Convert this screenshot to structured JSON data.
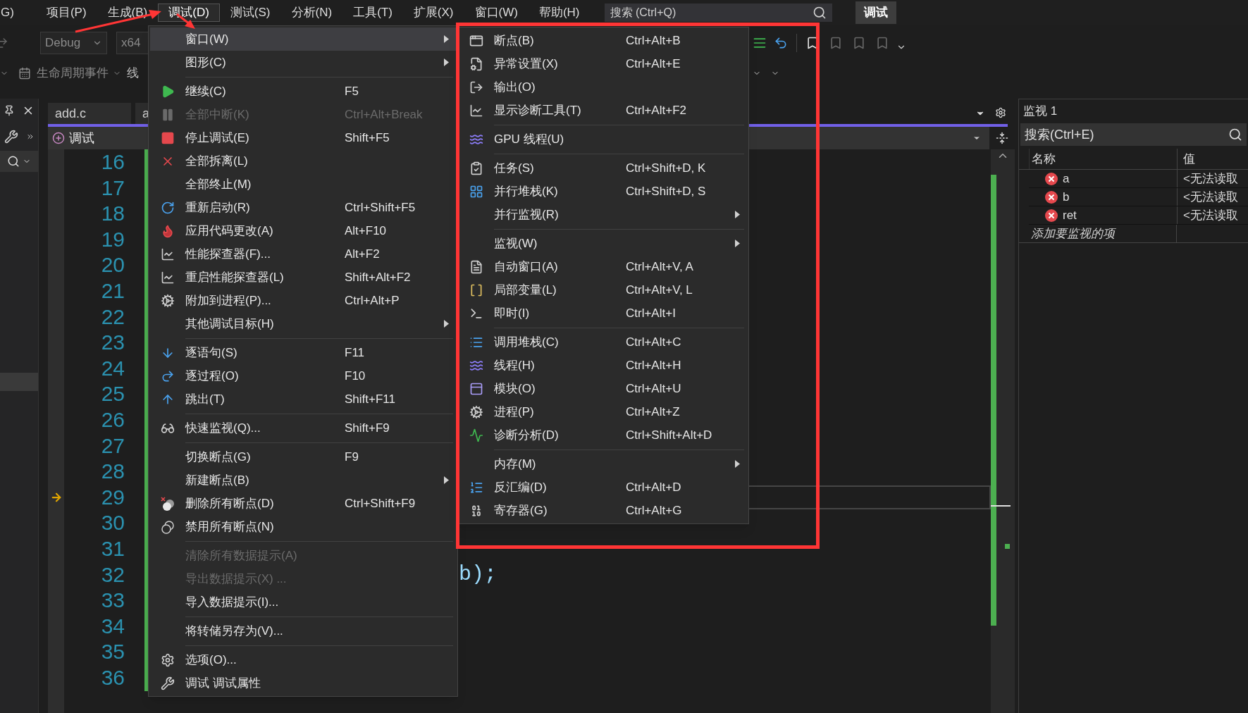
{
  "menu_bar": {
    "items": [
      {
        "label": "G)",
        "selected": false
      },
      {
        "label": "项目(P)",
        "selected": false
      },
      {
        "label": "生成(B)",
        "selected": false
      },
      {
        "label": "调试(D)",
        "selected": true
      },
      {
        "label": "测试(S)",
        "selected": false
      },
      {
        "label": "分析(N)",
        "selected": false
      },
      {
        "label": "工具(T)",
        "selected": false
      },
      {
        "label": "扩展(X)",
        "selected": false
      },
      {
        "label": "窗口(W)",
        "selected": false
      },
      {
        "label": "帮助(H)",
        "selected": false
      }
    ],
    "search": {
      "placeholder": "搜索 (Ctrl+Q)"
    },
    "badge": "调试"
  },
  "toolbar": {
    "configuration": "Debug",
    "platform": "x64",
    "lifecycle": "生命周期事件",
    "thread": "线"
  },
  "debug_menu": {
    "items": [
      {
        "kind": "item",
        "label": "窗口(W)",
        "submenu": true,
        "disabled": false,
        "selected": true
      },
      {
        "kind": "item",
        "label": "图形(C)",
        "submenu": true,
        "disabled": false,
        "selected": false
      },
      {
        "kind": "separator"
      },
      {
        "kind": "item",
        "label": "继续(C)",
        "shortcut": "F5",
        "submenu": false,
        "disabled": false,
        "selected": false
      },
      {
        "kind": "item",
        "label": "全部中断(K)",
        "shortcut": "Ctrl+Alt+Break",
        "submenu": false,
        "disabled": true,
        "selected": false
      },
      {
        "kind": "item",
        "label": "停止调试(E)",
        "shortcut": "Shift+F5",
        "submenu": false,
        "disabled": false,
        "selected": false
      },
      {
        "kind": "item",
        "label": "全部拆离(L)",
        "submenu": false,
        "disabled": false,
        "selected": false
      },
      {
        "kind": "item",
        "label": "全部终止(M)",
        "submenu": false,
        "disabled": false,
        "selected": false
      },
      {
        "kind": "item",
        "label": "重新启动(R)",
        "shortcut": "Ctrl+Shift+F5",
        "submenu": false,
        "disabled": false,
        "selected": false
      },
      {
        "kind": "item",
        "label": "应用代码更改(A)",
        "shortcut": "Alt+F10",
        "submenu": false,
        "disabled": false,
        "selected": false
      },
      {
        "kind": "item",
        "label": "性能探查器(F)...",
        "shortcut": "Alt+F2",
        "submenu": false,
        "disabled": false,
        "selected": false
      },
      {
        "kind": "item",
        "label": "重启性能探查器(L)",
        "shortcut": "Shift+Alt+F2",
        "submenu": false,
        "disabled": false,
        "selected": false
      },
      {
        "kind": "item",
        "label": "附加到进程(P)...",
        "shortcut": "Ctrl+Alt+P",
        "submenu": false,
        "disabled": false,
        "selected": false
      },
      {
        "kind": "item",
        "label": "其他调试目标(H)",
        "submenu": true,
        "disabled": false,
        "selected": false
      },
      {
        "kind": "separator"
      },
      {
        "kind": "item",
        "label": "逐语句(S)",
        "shortcut": "F11",
        "submenu": false,
        "disabled": false,
        "selected": false
      },
      {
        "kind": "item",
        "label": "逐过程(O)",
        "shortcut": "F10",
        "submenu": false,
        "disabled": false,
        "selected": false
      },
      {
        "kind": "item",
        "label": "跳出(T)",
        "shortcut": "Shift+F11",
        "submenu": false,
        "disabled": false,
        "selected": false
      },
      {
        "kind": "separator"
      },
      {
        "kind": "item",
        "label": "快速监视(Q)...",
        "shortcut": "Shift+F9",
        "submenu": false,
        "disabled": false,
        "selected": false
      },
      {
        "kind": "separator"
      },
      {
        "kind": "item",
        "label": "切换断点(G)",
        "shortcut": "F9",
        "submenu": false,
        "disabled": false,
        "selected": false
      },
      {
        "kind": "item",
        "label": "新建断点(B)",
        "submenu": true,
        "disabled": false,
        "selected": false
      },
      {
        "kind": "item",
        "label": "删除所有断点(D)",
        "shortcut": "Ctrl+Shift+F9",
        "submenu": false,
        "disabled": false,
        "selected": false
      },
      {
        "kind": "item",
        "label": "禁用所有断点(N)",
        "submenu": false,
        "disabled": false,
        "selected": false
      },
      {
        "kind": "separator"
      },
      {
        "kind": "item",
        "label": "清除所有数据提示(A)",
        "submenu": false,
        "disabled": true,
        "selected": false
      },
      {
        "kind": "item",
        "label": "导出数据提示(X) ...",
        "submenu": false,
        "disabled": true,
        "selected": false
      },
      {
        "kind": "item",
        "label": "导入数据提示(I)...",
        "submenu": false,
        "disabled": false,
        "selected": false
      },
      {
        "kind": "separator"
      },
      {
        "kind": "item",
        "label": "将转储另存为(V)...",
        "submenu": false,
        "disabled": false,
        "selected": false
      },
      {
        "kind": "separator"
      },
      {
        "kind": "item",
        "label": "选项(O)...",
        "submenu": false,
        "disabled": false,
        "selected": false
      },
      {
        "kind": "item",
        "label": "调试 调试属性",
        "submenu": false,
        "disabled": false,
        "selected": false
      }
    ]
  },
  "window_submenu": {
    "items": [
      {
        "kind": "item",
        "label": "断点(B)",
        "shortcut": "Ctrl+Alt+B",
        "submenu": false,
        "selected": false
      },
      {
        "kind": "item",
        "label": "异常设置(X)",
        "shortcut": "Ctrl+Alt+E",
        "submenu": false,
        "selected": false
      },
      {
        "kind": "item",
        "label": "输出(O)",
        "submenu": false,
        "selected": false
      },
      {
        "kind": "item",
        "label": "显示诊断工具(T)",
        "shortcut": "Ctrl+Alt+F2",
        "submenu": false,
        "selected": false
      },
      {
        "kind": "separator"
      },
      {
        "kind": "item",
        "label": "GPU 线程(U)",
        "submenu": false,
        "selected": false
      },
      {
        "kind": "separator"
      },
      {
        "kind": "item",
        "label": "任务(S)",
        "shortcut": "Ctrl+Shift+D, K",
        "submenu": false,
        "selected": false
      },
      {
        "kind": "item",
        "label": "并行堆栈(K)",
        "shortcut": "Ctrl+Shift+D, S",
        "submenu": false,
        "selected": false
      },
      {
        "kind": "item",
        "label": "并行监视(R)",
        "submenu": true,
        "selected": false
      },
      {
        "kind": "separator"
      },
      {
        "kind": "item",
        "label": "监视(W)",
        "submenu": true,
        "selected": false
      },
      {
        "kind": "item",
        "label": "自动窗口(A)",
        "shortcut": "Ctrl+Alt+V, A",
        "submenu": false,
        "selected": false
      },
      {
        "kind": "item",
        "label": "局部变量(L)",
        "shortcut": "Ctrl+Alt+V, L",
        "submenu": false,
        "selected": false
      },
      {
        "kind": "item",
        "label": "即时(I)",
        "shortcut": "Ctrl+Alt+I",
        "submenu": false,
        "selected": false
      },
      {
        "kind": "separator"
      },
      {
        "kind": "item",
        "label": "调用堆栈(C)",
        "shortcut": "Ctrl+Alt+C",
        "submenu": false,
        "selected": false
      },
      {
        "kind": "item",
        "label": "线程(H)",
        "shortcut": "Ctrl+Alt+H",
        "submenu": false,
        "selected": false
      },
      {
        "kind": "item",
        "label": "模块(O)",
        "shortcut": "Ctrl+Alt+U",
        "submenu": false,
        "selected": false
      },
      {
        "kind": "item",
        "label": "进程(P)",
        "shortcut": "Ctrl+Alt+Z",
        "submenu": false,
        "selected": false
      },
      {
        "kind": "item",
        "label": "诊断分析(D)",
        "shortcut": "Ctrl+Shift+Alt+D",
        "submenu": false,
        "selected": false
      },
      {
        "kind": "separator"
      },
      {
        "kind": "item",
        "label": "内存(M)",
        "submenu": true,
        "selected": false
      },
      {
        "kind": "item",
        "label": "反汇编(D)",
        "shortcut": "Ctrl+Alt+D",
        "submenu": false,
        "selected": false
      },
      {
        "kind": "item",
        "label": "寄存器(G)",
        "shortcut": "Ctrl+Alt+G",
        "submenu": false,
        "selected": false
      }
    ]
  },
  "editor": {
    "tabs": [
      {
        "label": "add.c",
        "selected": false
      },
      {
        "label": "a",
        "selected": false
      }
    ],
    "nav_bar": {
      "label": "调试"
    },
    "lines": [
      {
        "number": "16",
        "current": false
      },
      {
        "number": "17",
        "current": false
      },
      {
        "number": "18",
        "current": false
      },
      {
        "number": "19",
        "current": false
      },
      {
        "number": "20",
        "current": false
      },
      {
        "number": "21",
        "current": false
      },
      {
        "number": "22",
        "current": false
      },
      {
        "number": "23",
        "current": false
      },
      {
        "number": "24",
        "current": false
      },
      {
        "number": "25",
        "current": false
      },
      {
        "number": "26",
        "current": false
      },
      {
        "number": "27",
        "current": false
      },
      {
        "number": "28",
        "current": false
      },
      {
        "number": "29",
        "current": true
      },
      {
        "number": "30",
        "current": false
      },
      {
        "number": "31",
        "current": false
      },
      {
        "number": "32",
        "current": false,
        "code": "b);"
      },
      {
        "number": "33",
        "current": false
      },
      {
        "number": "34",
        "current": false
      },
      {
        "number": "35",
        "current": false
      },
      {
        "number": "36",
        "current": false
      }
    ]
  },
  "watch": {
    "title": "监视 1",
    "search": {
      "placeholder": "搜索(Ctrl+E)"
    },
    "columns": [
      "名称",
      "值"
    ],
    "rows": [
      {
        "name": "a",
        "value": "<无法读取",
        "error": true
      },
      {
        "name": "b",
        "value": "<无法读取",
        "error": true
      },
      {
        "name": "ret",
        "value": "<无法读取",
        "error": true
      }
    ],
    "add_hint": "添加要监视的项"
  }
}
